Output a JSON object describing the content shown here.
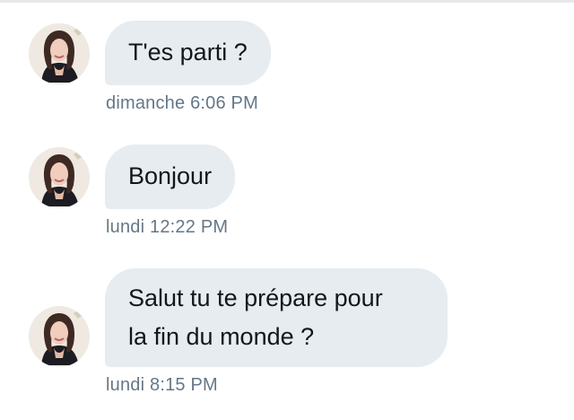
{
  "conversation": {
    "messages": [
      {
        "text": "T'es parti ?",
        "timestamp": "dimanche 6:06 PM"
      },
      {
        "text": "Bonjour",
        "timestamp": "lundi 12:22 PM"
      },
      {
        "text": "Salut tu te prépare pour\nla fin du monde ?",
        "timestamp": "lundi 8:15 PM"
      }
    ]
  },
  "colors": {
    "bubble_bg": "#e6ecf0",
    "text": "#14171a",
    "timestamp": "#657786"
  }
}
